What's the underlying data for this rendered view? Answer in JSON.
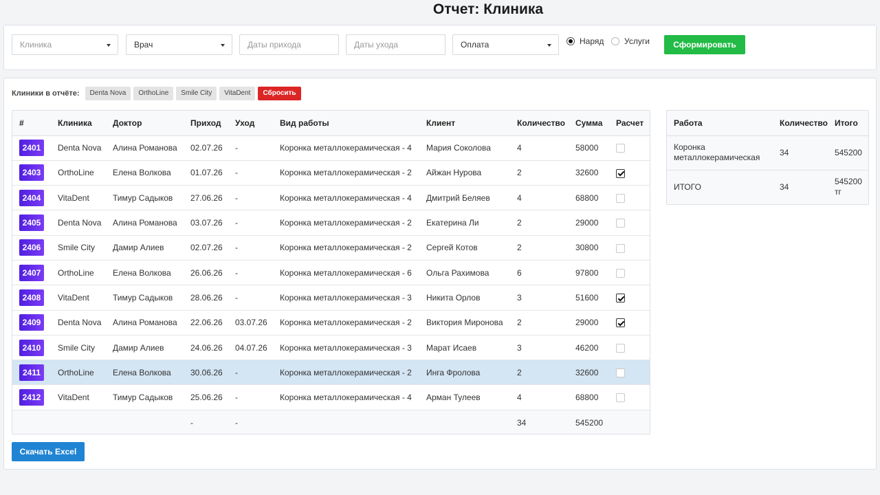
{
  "page_title": "Отчет: Клиника",
  "filters": {
    "clinic_placeholder": "Клиника",
    "doctor_value": "Врач",
    "arrival_placeholder": "Даты прихода",
    "departure_placeholder": "Даты ухода",
    "payment_value": "Оплата",
    "radio_order_label": "Наряд",
    "radio_services_label": "Услуги",
    "selected_radio": "Наряд",
    "generate_label": "Сформировать"
  },
  "clinics": {
    "label": "Клиники в отчёте:",
    "chips": [
      "Denta Nova",
      "OrthoLine",
      "Smile City",
      "VitaDent"
    ],
    "reset_label": "Сбросить"
  },
  "table": {
    "headers": [
      "#",
      "Клиника",
      "Доктор",
      "Приход",
      "Уход",
      "Вид работы",
      "Клиент",
      "Количество",
      "Сумма",
      "Расчет"
    ],
    "rows": [
      {
        "id": "2401",
        "clinic": "Denta Nova",
        "doctor": "Алина Романова",
        "in": "02.07.26",
        "out": "-",
        "work": "Коронка металлокерамическая - 4",
        "client": "Мария Соколова",
        "qty": "4",
        "sum": "58000",
        "paid": false,
        "highlight": false
      },
      {
        "id": "2403",
        "clinic": "OrthoLine",
        "doctor": "Елена Волкова",
        "in": "01.07.26",
        "out": "-",
        "work": "Коронка металлокерамическая - 2",
        "client": "Айжан Нурова",
        "qty": "2",
        "sum": "32600",
        "paid": true,
        "highlight": false
      },
      {
        "id": "2404",
        "clinic": "VitaDent",
        "doctor": "Тимур Садыков",
        "in": "27.06.26",
        "out": "-",
        "work": "Коронка металлокерамическая - 4",
        "client": "Дмитрий Беляев",
        "qty": "4",
        "sum": "68800",
        "paid": false,
        "highlight": false
      },
      {
        "id": "2405",
        "clinic": "Denta Nova",
        "doctor": "Алина Романова",
        "in": "03.07.26",
        "out": "-",
        "work": "Коронка металлокерамическая - 2",
        "client": "Екатерина Ли",
        "qty": "2",
        "sum": "29000",
        "paid": false,
        "highlight": false
      },
      {
        "id": "2406",
        "clinic": "Smile City",
        "doctor": "Дамир Алиев",
        "in": "02.07.26",
        "out": "-",
        "work": "Коронка металлокерамическая - 2",
        "client": "Сергей Котов",
        "qty": "2",
        "sum": "30800",
        "paid": false,
        "highlight": false
      },
      {
        "id": "2407",
        "clinic": "OrthoLine",
        "doctor": "Елена Волкова",
        "in": "26.06.26",
        "out": "-",
        "work": "Коронка металлокерамическая - 6",
        "client": "Ольга Рахимова",
        "qty": "6",
        "sum": "97800",
        "paid": false,
        "highlight": false
      },
      {
        "id": "2408",
        "clinic": "VitaDent",
        "doctor": "Тимур Садыков",
        "in": "28.06.26",
        "out": "-",
        "work": "Коронка металлокерамическая - 3",
        "client": "Никита Орлов",
        "qty": "3",
        "sum": "51600",
        "paid": true,
        "highlight": false
      },
      {
        "id": "2409",
        "clinic": "Denta Nova",
        "doctor": "Алина Романова",
        "in": "22.06.26",
        "out": "03.07.26",
        "work": "Коронка металлокерамическая - 2",
        "client": "Виктория Миронова",
        "qty": "2",
        "sum": "29000",
        "paid": true,
        "highlight": false
      },
      {
        "id": "2410",
        "clinic": "Smile City",
        "doctor": "Дамир Алиев",
        "in": "24.06.26",
        "out": "04.07.26",
        "work": "Коронка металлокерамическая - 3",
        "client": "Марат Исаев",
        "qty": "3",
        "sum": "46200",
        "paid": false,
        "highlight": false
      },
      {
        "id": "2411",
        "clinic": "OrthoLine",
        "doctor": "Елена Волкова",
        "in": "30.06.26",
        "out": "-",
        "work": "Коронка металлокерамическая - 2",
        "client": "Инга Фролова",
        "qty": "2",
        "sum": "32600",
        "paid": false,
        "highlight": true
      },
      {
        "id": "2412",
        "clinic": "VitaDent",
        "doctor": "Тимур Садыков",
        "in": "25.06.26",
        "out": "-",
        "work": "Коронка металлокерамическая - 4",
        "client": "Арман Тулеев",
        "qty": "4",
        "sum": "68800",
        "paid": false,
        "highlight": false
      }
    ],
    "footer": {
      "in": "-",
      "out": "-",
      "qty": "34",
      "sum": "545200"
    }
  },
  "summary": {
    "headers": [
      "Работа",
      "Количество",
      "Итого"
    ],
    "rows": [
      {
        "work": "Коронка металлокерамическая",
        "qty": "34",
        "total": "545200"
      },
      {
        "work": "ИТОГО",
        "qty": "34",
        "total": "545200 тг"
      }
    ]
  },
  "download_label": "Скачать Excel",
  "colors": {
    "accent_green": "#22bb46",
    "accent_blue": "#1f84d3",
    "reset_red": "#dc2626",
    "id_badge": "#5b21e6",
    "row_highlight": "#d4e5f3"
  }
}
